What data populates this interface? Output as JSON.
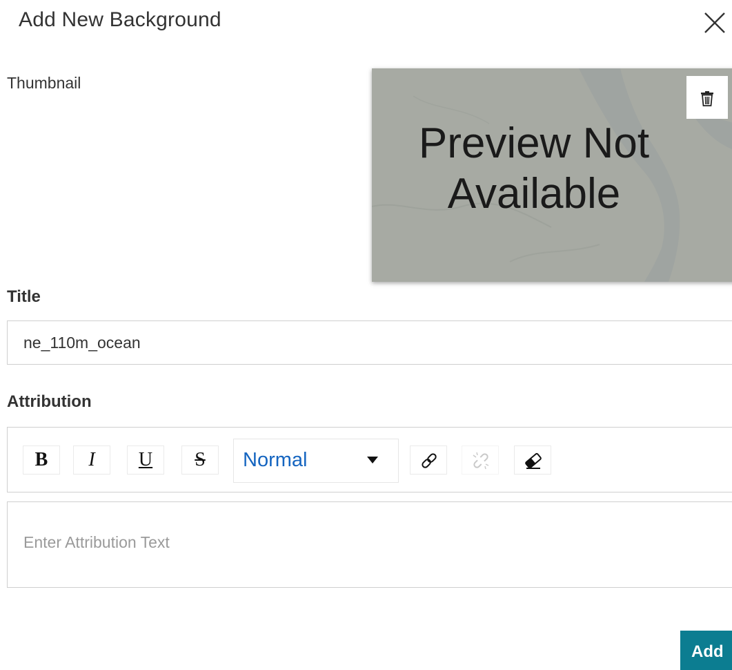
{
  "dialog": {
    "title": "Add New Background",
    "close_icon": "close-icon"
  },
  "thumbnail": {
    "label": "Thumbnail",
    "preview_line1": "Preview Not",
    "preview_line2": "Available",
    "delete_icon": "trash-icon"
  },
  "title_field": {
    "label": "Title",
    "value": "ne_110m_ocean"
  },
  "attribution": {
    "label": "Attribution",
    "toolbar": {
      "bold": "B",
      "italic": "I",
      "underline": "U",
      "strikethrough": "S",
      "heading_select": "Normal",
      "link_icon": "link-icon",
      "unlink_icon": "unlink-icon",
      "clear_format_icon": "eraser-icon"
    },
    "placeholder": "Enter Attribution Text"
  },
  "actions": {
    "add_label": "Add"
  },
  "colors": {
    "primary_button": "#0c7d91",
    "select_text": "#1565c0",
    "placeholder_text": "#9a9a9a"
  }
}
